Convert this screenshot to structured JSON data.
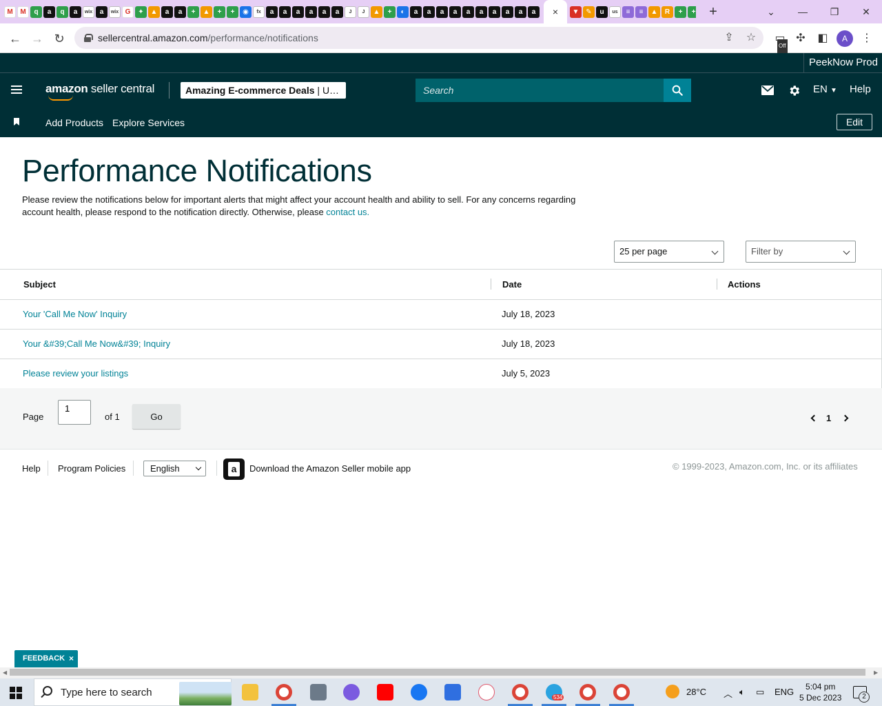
{
  "browser": {
    "active_tab_close": "×",
    "new_tab": "+",
    "url_domain": "sellercentral.amazon.com",
    "url_path": "/performance/notifications",
    "ext_off_badge": "Off",
    "profile_initial": "A"
  },
  "header": {
    "account_name": "PeekNow Prod",
    "logo_brand": "amazon",
    "logo_product": " seller central",
    "store_name": "Amazing E-commerce Deals",
    "store_suffix": " | U…",
    "search_placeholder": "Search",
    "language": "EN",
    "help": "Help"
  },
  "subnav": {
    "items": [
      "Add Products",
      "Explore Services"
    ],
    "edit_label": "Edit"
  },
  "page": {
    "title": "Performance Notifications",
    "intro_text": "Please review the notifications below for important alerts that might affect your account health and ability to sell. For any concerns regarding account health, please respond to the notification directly. Otherwise, please ",
    "intro_link": "contact us."
  },
  "controls": {
    "per_page": "25 per page",
    "filter_placeholder": "Filter by"
  },
  "table": {
    "columns": [
      "Subject",
      "Date",
      "Actions"
    ],
    "rows": [
      {
        "subject": "Your 'Call Me Now' Inquiry",
        "date": "July 18, 2023"
      },
      {
        "subject": "Your &#39;Call Me Now&#39; Inquiry",
        "date": "July 18, 2023"
      },
      {
        "subject": "Please review your listings",
        "date": "July 5, 2023"
      }
    ]
  },
  "pager": {
    "page_label": "Page",
    "current_value": "1",
    "of_label": "of 1",
    "go_label": "Go",
    "page_number": "1"
  },
  "footer": {
    "help": "Help",
    "program_policies": "Program Policies",
    "language": "English",
    "app_icon_letter": "a",
    "download_app": "Download the Amazon Seller mobile app",
    "copyright": "© 1999-2023, Amazon.com, Inc. or its affiliates"
  },
  "feedback": {
    "label": "FEEDBACK",
    "close": "×"
  },
  "taskbar": {
    "search_placeholder": "Type here to search",
    "temperature": "28°C",
    "language": "ENG",
    "time": "5:04 pm",
    "date": "5 Dec 2023",
    "notification_count": "2",
    "telegram_badge": "534"
  },
  "colors": {
    "header_bg": "#002f36",
    "accent_teal": "#008296",
    "search_bg": "#00626b",
    "tabstrip_bg": "#e6cff5"
  }
}
